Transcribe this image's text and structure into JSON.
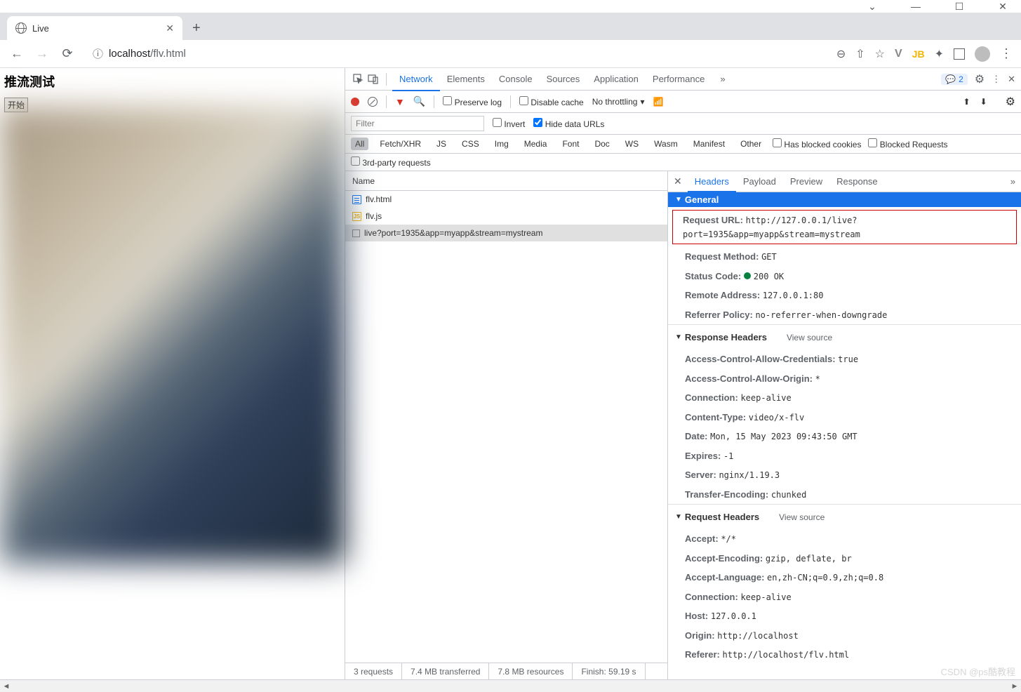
{
  "window": {
    "title": "Live",
    "min": "―",
    "max": "☐",
    "close": "✕",
    "chevron": "⌄"
  },
  "tab": {
    "title": "Live",
    "close": "✕",
    "plus": "+"
  },
  "url": {
    "info": "ⓘ",
    "host": "localhost",
    "path": "/flv.html",
    "back": "←",
    "forward": "→",
    "reload": "⟳"
  },
  "toolbar_icons": {
    "zoom": "⊖",
    "share": "⇧",
    "star": "☆",
    "v": "V",
    "jb": "JB",
    "ext": "✦",
    "dots": "⋮"
  },
  "page": {
    "h1": "推流测试",
    "btn": "开始"
  },
  "devtools": {
    "tabs": [
      "Network",
      "Elements",
      "Console",
      "Sources",
      "Application",
      "Performance"
    ],
    "active": 0,
    "more": "»",
    "badge": "2",
    "gear": "⚙",
    "dots": "⋮",
    "close": "✕",
    "row2": {
      "preserve": "Preserve log",
      "disable": "Disable cache",
      "throttle": "No throttling",
      "up": "⬆",
      "down": "⬇",
      "wifi": "⋮",
      "arrow": "▾"
    },
    "row3": {
      "filter": "Filter",
      "invert": "Invert",
      "hide": "Hide data URLs"
    },
    "types": [
      "All",
      "Fetch/XHR",
      "JS",
      "CSS",
      "Img",
      "Media",
      "Font",
      "Doc",
      "WS",
      "Wasm",
      "Manifest",
      "Other"
    ],
    "extra": [
      "Has blocked cookies",
      "Blocked Requests",
      "3rd-party requests"
    ],
    "reqlist": {
      "name": "Name",
      "items": [
        {
          "icon": "doc",
          "text": "flv.html"
        },
        {
          "icon": "js",
          "text": "flv.js"
        },
        {
          "icon": "other",
          "text": "live?port=1935&app=myapp&stream=mystream"
        }
      ]
    },
    "detail_tabs": [
      "Headers",
      "Payload",
      "Preview",
      "Response"
    ],
    "detail_active": 0,
    "general": {
      "title": "General",
      "url_k": "Request URL:",
      "url_v": "http://127.0.0.1/live?port=1935&app=myapp&stream=mystream",
      "method_k": "Request Method:",
      "method_v": "GET",
      "status_k": "Status Code:",
      "status_v": "200 OK",
      "remote_k": "Remote Address:",
      "remote_v": "127.0.0.1:80",
      "ref_k": "Referrer Policy:",
      "ref_v": "no-referrer-when-downgrade"
    },
    "resp": {
      "title": "Response Headers",
      "vs": "View source",
      "h": [
        [
          "Access-Control-Allow-Credentials:",
          "true"
        ],
        [
          "Access-Control-Allow-Origin:",
          "*"
        ],
        [
          "Connection:",
          "keep-alive"
        ],
        [
          "Content-Type:",
          "video/x-flv"
        ],
        [
          "Date:",
          "Mon, 15 May 2023 09:43:50 GMT"
        ],
        [
          "Expires:",
          "-1"
        ],
        [
          "Server:",
          "nginx/1.19.3"
        ],
        [
          "Transfer-Encoding:",
          "chunked"
        ]
      ]
    },
    "req": {
      "title": "Request Headers",
      "vs": "View source",
      "h": [
        [
          "Accept:",
          "*/*"
        ],
        [
          "Accept-Encoding:",
          "gzip, deflate, br"
        ],
        [
          "Accept-Language:",
          "en,zh-CN;q=0.9,zh;q=0.8"
        ],
        [
          "Connection:",
          "keep-alive"
        ],
        [
          "Host:",
          "127.0.0.1"
        ],
        [
          "Origin:",
          "http://localhost"
        ],
        [
          "Referer:",
          "http://localhost/flv.html"
        ]
      ]
    },
    "status": [
      "3 requests",
      "7.4 MB transferred",
      "7.8 MB resources",
      "Finish: 59.19 s"
    ]
  },
  "watermark": "CSDN @ps酷教程"
}
